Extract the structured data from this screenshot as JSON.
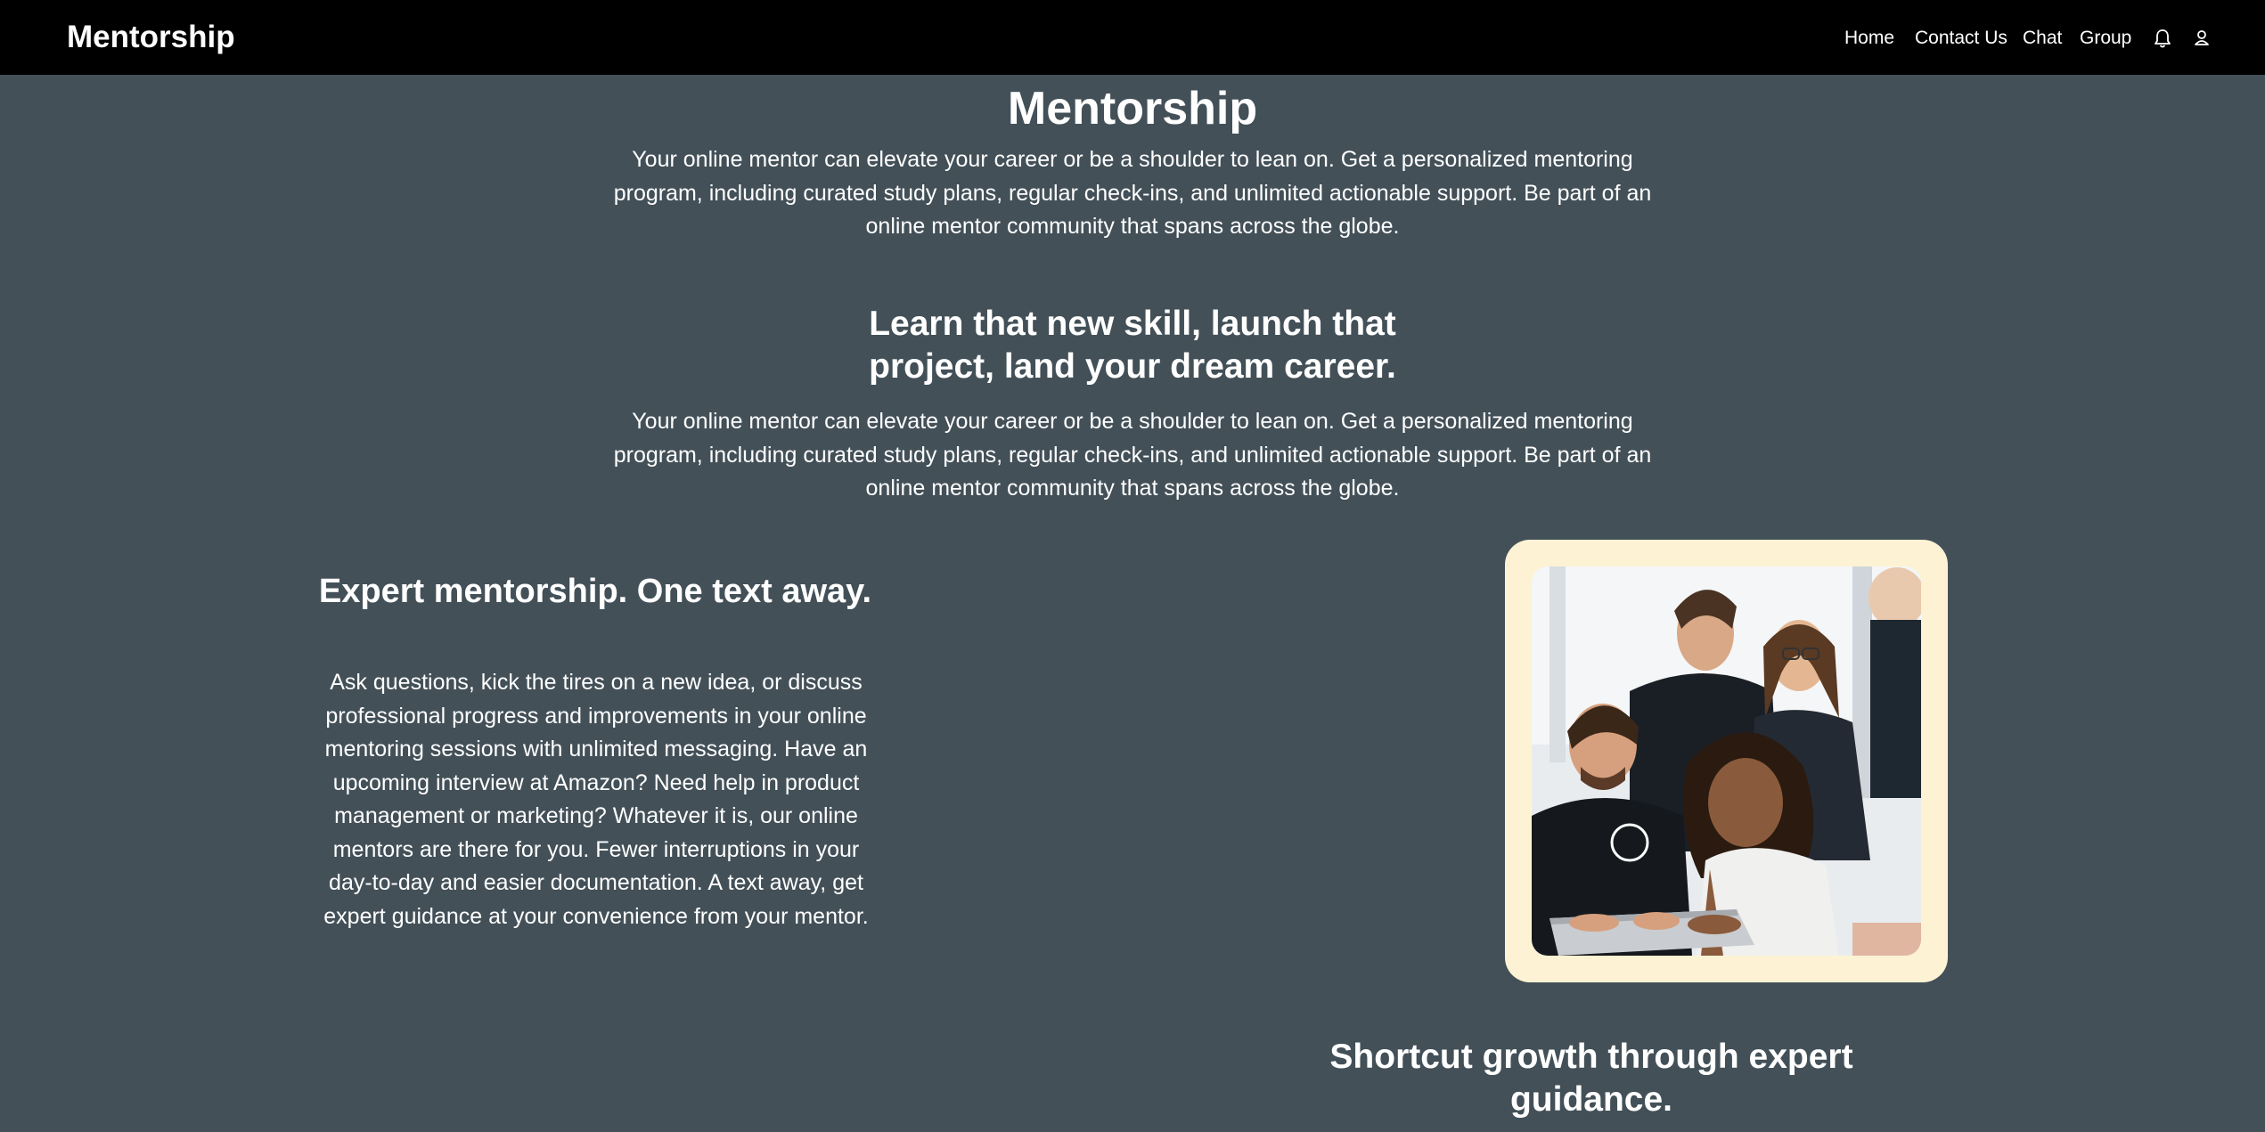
{
  "navbar": {
    "brand": "Mentorship",
    "links": [
      "Home",
      "Contact Us",
      "Chat",
      "Group"
    ],
    "icons": [
      "bell-icon",
      "user-icon"
    ]
  },
  "hero": {
    "title": "Mentorship",
    "text": "Your online mentor can elevate your career or be a shoulder to lean on. Get a personalized mentoring program, including curated study plans, regular check-ins, and unlimited actionable support. Be part of an online mentor community that spans across the globe."
  },
  "section2": {
    "title": "Learn that new skill, launch that project, land your dream career.",
    "text": "Your online mentor can elevate your career or be a shoulder to lean on. Get a personalized mentoring program, including curated study plans, regular check-ins, and unlimited actionable support. Be part of an online mentor community that spans across the globe."
  },
  "section3": {
    "title": "Expert mentorship. One text away.",
    "text": "Ask questions, kick the tires on a new idea, or discuss professional progress and improvements in your online mentoring sessions with unlimited messaging. Have an upcoming interview at Amazon? Need help in product management or marketing? Whatever it is, our online mentors are there for you. Fewer interruptions in your day-to-day and easier documentation. A text away, get expert guidance at your convenience from your mentor.",
    "image_alt": "group-of-people-at-laptop-photo"
  },
  "section4": {
    "title": "Shortcut growth through expert guidance."
  },
  "colors": {
    "background": "#435058",
    "navbar": "#000000",
    "photo_frame": "#fdf3d4"
  }
}
